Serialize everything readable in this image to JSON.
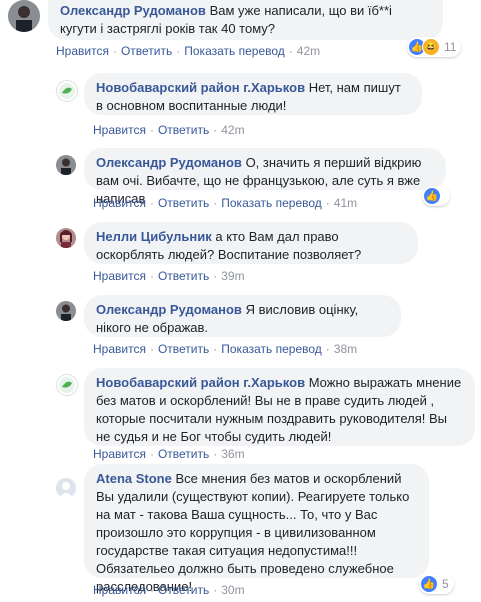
{
  "actions": {
    "like": "Нравится",
    "reply": "Ответить",
    "translate": "Показать перевод"
  },
  "comments": [
    {
      "author": "Олександр Рудоманов",
      "text": "Вам уже написали, що ви їб**і кугути і застряглі років так 40 тому?",
      "time": "42m",
      "reactions": {
        "count": "11",
        "types": [
          "like-icon",
          "haha-icon"
        ]
      }
    },
    {
      "author": "Новобаварский район г.Харьков",
      "text": "Нет, нам пишут в основном воспитанные люди!",
      "time": "42m"
    },
    {
      "author": "Олександр Рудоманов",
      "text": "О, значить я перший відкрию вам очі. Вибачте, що не французькою, але суть я вже написав",
      "time": "41m",
      "reactions": {
        "count": "",
        "types": [
          "like-icon"
        ]
      }
    },
    {
      "author": "Нелли Цибульник",
      "text": "а кто Вам дал право оскорблять людей? Воспитание позволяет?",
      "time": "39m"
    },
    {
      "author": "Олександр Рудоманов",
      "text": "Я висловив оцінку, нікого не ображав.",
      "time": "38m"
    },
    {
      "author": "Новобаварский район г.Харьков",
      "text": "Можно выражать мнение без матов и оскорблений! Вы не в праве судить людей , которые посчитали нужным поздравить руководителя! Вы не судья и не Бог чтобы судить людей!",
      "time": "36m"
    },
    {
      "author": "Atena Stone",
      "text": "Все мнения без матов и оскорблений Вы удалили (существуют копии). Реагируете только на мат - такова Ваша сущность... То, что у Вас произошло это коррупция - в цивилизованном государстве такая ситуация недопустима!!! Обязательео должно быть проведено служебное расследование!",
      "time": "30m",
      "reactions": {
        "count": "5",
        "types": [
          "like-icon"
        ]
      }
    }
  ],
  "colors": {
    "link": "#385898",
    "meta": "#90949c",
    "bubble": "#f2f3f5",
    "like": "#4080ff"
  }
}
